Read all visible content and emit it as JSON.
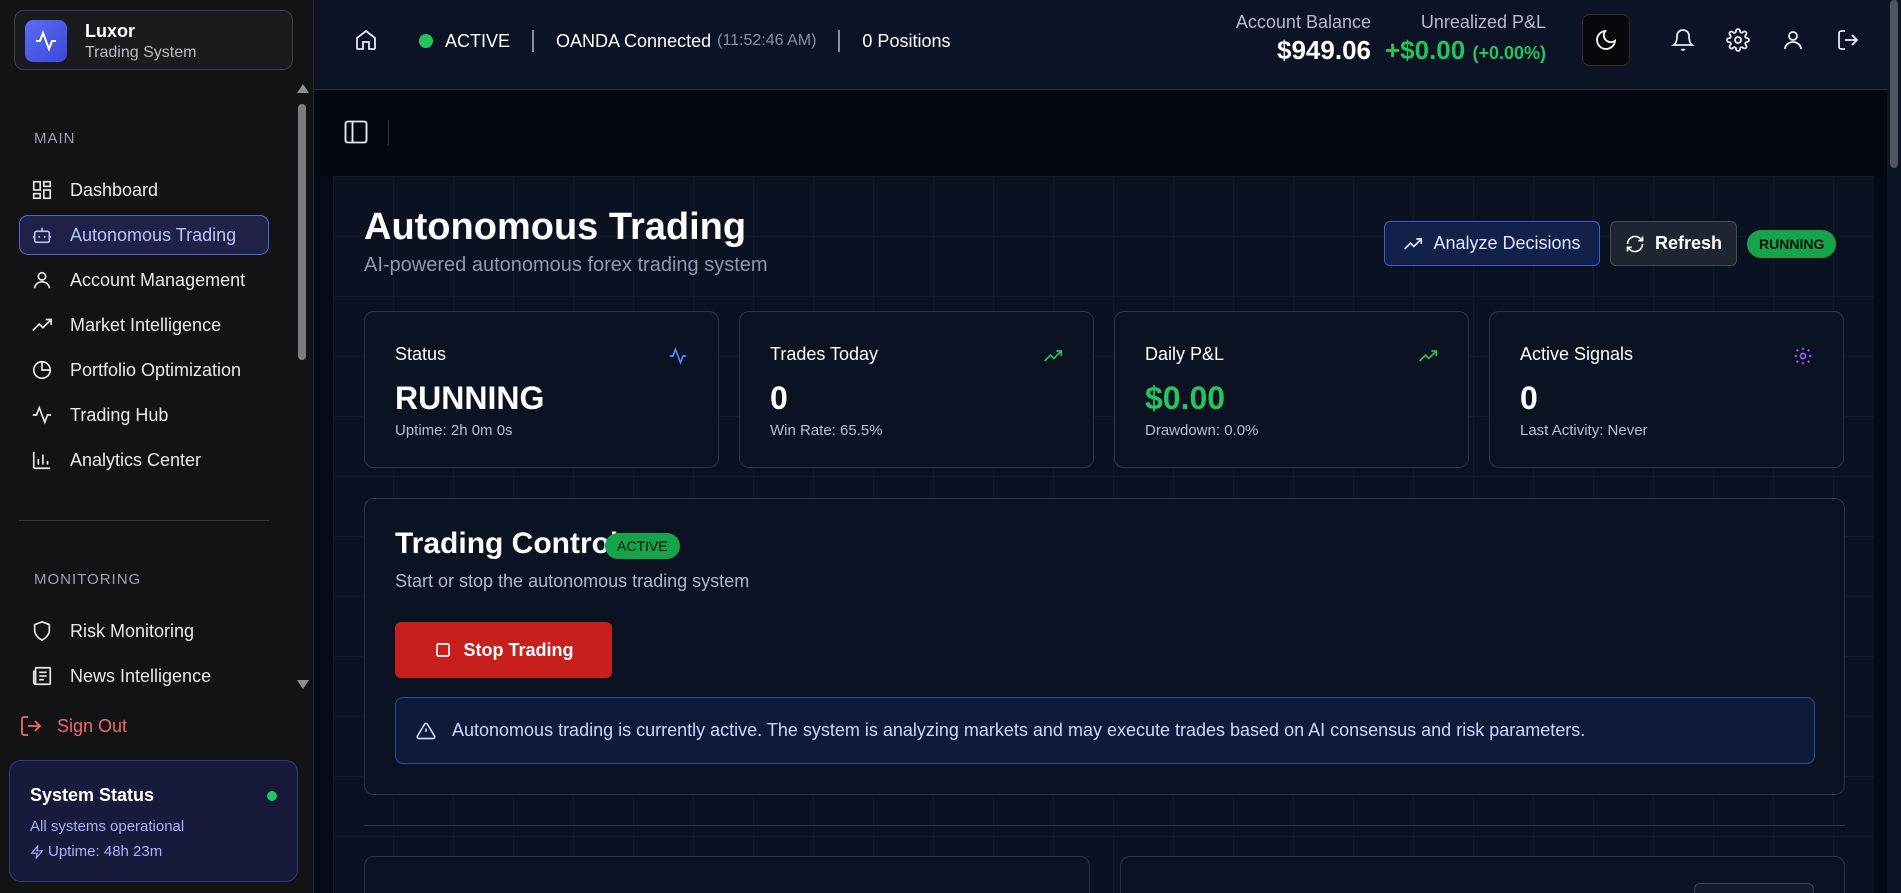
{
  "brand": {
    "name": "Luxor",
    "subtitle": "Trading System"
  },
  "sidebar": {
    "sections": [
      {
        "label": "MAIN",
        "items": [
          {
            "label": "Dashboard",
            "icon": "dashboard-icon"
          },
          {
            "label": "Autonomous Trading",
            "icon": "bot-icon",
            "active": true
          },
          {
            "label": "Account Management",
            "icon": "user-icon"
          },
          {
            "label": "Market Intelligence",
            "icon": "trending-up-icon"
          },
          {
            "label": "Portfolio Optimization",
            "icon": "pie-chart-icon"
          },
          {
            "label": "Trading Hub",
            "icon": "activity-icon"
          },
          {
            "label": "Analytics Center",
            "icon": "bar-chart-icon"
          }
        ]
      },
      {
        "label": "MONITORING",
        "items": [
          {
            "label": "Risk Monitoring",
            "icon": "shield-icon"
          },
          {
            "label": "News Intelligence",
            "icon": "newspaper-icon"
          }
        ]
      }
    ],
    "sign_out": "Sign Out",
    "system_status": {
      "title": "System Status",
      "text": "All systems operational",
      "uptime": "Uptime: 48h 23m"
    }
  },
  "topbar": {
    "status": "ACTIVE",
    "connection": "OANDA Connected",
    "connection_time": "(11:52:46 AM)",
    "positions": "0 Positions",
    "balance_label": "Account Balance",
    "balance_value": "$949.06",
    "pnl_label": "Unrealized P&L",
    "pnl_value": "+$0.00",
    "pnl_pct": "(+0.00%)"
  },
  "page": {
    "title": "Autonomous Trading",
    "subtitle": "AI-powered autonomous forex trading system",
    "analyze_button": "Analyze Decisions",
    "refresh_button": "Refresh",
    "status_badge": "RUNNING"
  },
  "cards": [
    {
      "title": "Status",
      "value": "RUNNING",
      "sub": "Uptime: 2h 0m 0s",
      "icon": "activity-icon",
      "icon_color": "#4f8cf7"
    },
    {
      "title": "Trades Today",
      "value": "0",
      "sub": "Win Rate: 65.5%",
      "icon": "trending-up-icon",
      "icon_color": "#22c55e"
    },
    {
      "title": "Daily P&L",
      "value": "$0.00",
      "sub": "Drawdown: 0.0%",
      "icon": "trending-up-icon",
      "icon_color": "#22c55e",
      "value_color": "#22c55e"
    },
    {
      "title": "Active Signals",
      "value": "0",
      "sub": "Last Activity: Never",
      "icon": "gear-icon",
      "icon_color": "#a855f7"
    }
  ],
  "controls": {
    "title": "Trading Controls",
    "badge": "ACTIVE",
    "subtitle": "Start or stop the autonomous trading system",
    "stop_button": "Stop Trading",
    "alert": "Autonomous trading is currently active. The system is analyzing markets and may execute trades based on AI consensus and risk parameters."
  },
  "colors": {
    "accent": "#5b5fd6",
    "success": "#22c55e",
    "danger": "#c81e1e",
    "bg": "#050a18"
  }
}
